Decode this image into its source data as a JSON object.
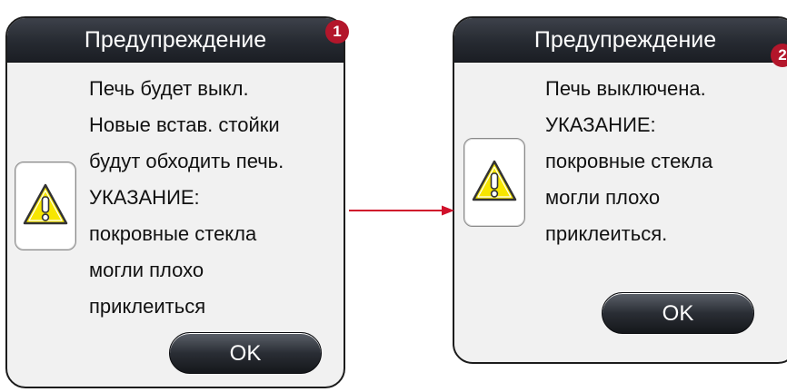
{
  "dialogs": [
    {
      "title": "Предупреждение",
      "badge": "1",
      "lines": [
        "Печь будет выкл.",
        "Новые встав. стойки",
        "будут обходить печь.",
        "УКАЗАНИЕ:",
        "покровные стекла",
        "могли плохо",
        "приклеиться"
      ],
      "ok_label": "OK",
      "icon": "warning-triangle-icon"
    },
    {
      "title": "Предупреждение",
      "badge": "2",
      "lines": [
        "Печь выключена.",
        "УКАЗАНИЕ:",
        "покровные стекла",
        "могли плохо",
        "приклеиться."
      ],
      "ok_label": "OK",
      "icon": "warning-triangle-icon"
    }
  ],
  "colors": {
    "title_bar": "#262a31",
    "dialog_bg": "#f1f1f1",
    "warning_yellow": "#f7e600",
    "badge_red": "#b3162b",
    "arrow_red": "#d0112b"
  }
}
